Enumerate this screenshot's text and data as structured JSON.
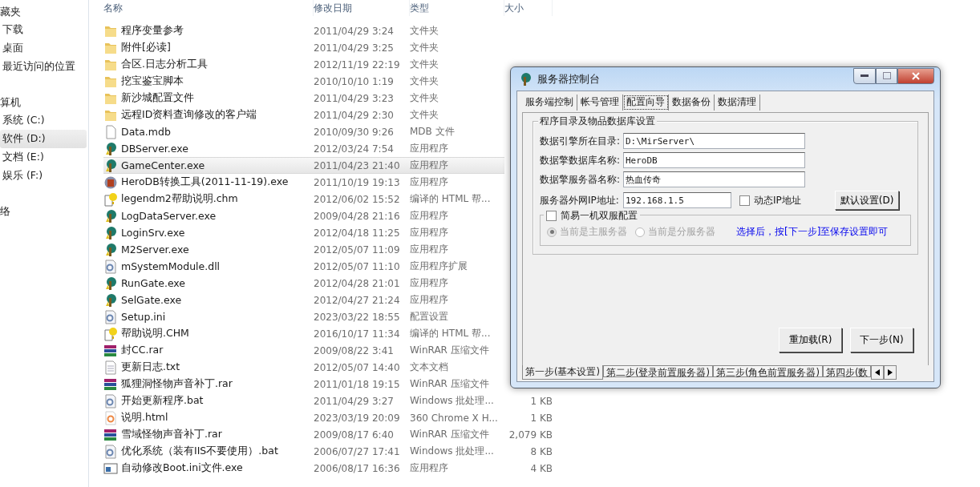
{
  "sidebar": {
    "items": [
      {
        "label": "藏夹",
        "kind": "header",
        "selected": false
      },
      {
        "label": "下载",
        "kind": "item",
        "selected": false
      },
      {
        "label": "桌面",
        "kind": "item",
        "selected": false
      },
      {
        "label": "最近访问的位置",
        "kind": "item",
        "selected": false
      },
      {
        "label": "算机",
        "kind": "header",
        "selected": false
      },
      {
        "label": "系统 (C:)",
        "kind": "item",
        "selected": false
      },
      {
        "label": "软件 (D:)",
        "kind": "item",
        "selected": true
      },
      {
        "label": "文档 (E:)",
        "kind": "item",
        "selected": false
      },
      {
        "label": "娱乐 (F:)",
        "kind": "item",
        "selected": false
      },
      {
        "label": "络",
        "kind": "header",
        "selected": false
      }
    ]
  },
  "file_list": {
    "columns": [
      "名称",
      "修改日期",
      "类型",
      "大小"
    ],
    "rows": [
      {
        "name": "程序变量参考",
        "date": "2011/04/29 3:24",
        "type": "文件夹",
        "kind": "folder",
        "selected": false
      },
      {
        "name": "附件[必读]",
        "date": "2011/04/29 3:25",
        "type": "文件夹",
        "kind": "folder",
        "selected": false
      },
      {
        "name": "合区.日志分析工具",
        "date": "2012/11/19 22:19",
        "type": "文件夹",
        "kind": "folder",
        "selected": false
      },
      {
        "name": "挖宝鉴宝脚本",
        "date": "2010/10/10 1:19",
        "type": "文件夹",
        "kind": "folder",
        "selected": false
      },
      {
        "name": "新沙城配置文件",
        "date": "2011/04/29 3:23",
        "type": "文件夹",
        "kind": "folder",
        "selected": false
      },
      {
        "name": "远程ID资料查询修改的客户端",
        "date": "2011/04/29 2:30",
        "type": "文件夹",
        "kind": "folder",
        "selected": false
      },
      {
        "name": "Data.mdb",
        "date": "2010/09/30 9:26",
        "type": "MDB 文件",
        "kind": "file",
        "selected": false
      },
      {
        "name": "DBServer.exe",
        "date": "2012/03/24 7:54",
        "type": "应用程序",
        "kind": "game",
        "selected": false
      },
      {
        "name": "GameCenter.exe",
        "date": "2011/04/23 21:40",
        "type": "应用程序",
        "kind": "game",
        "selected": true
      },
      {
        "name": "HeroDB转换工具(2011-11-19).exe",
        "date": "2011/10/19 19:13",
        "type": "应用程序",
        "kind": "tool",
        "selected": false
      },
      {
        "name": "legendm2帮助说明.chm",
        "date": "2012/06/02 15:52",
        "type": "编译的 HTML 帮...",
        "kind": "help",
        "selected": false
      },
      {
        "name": "LogDataServer.exe",
        "date": "2009/04/28 21:16",
        "type": "应用程序",
        "kind": "game",
        "selected": false
      },
      {
        "name": "LoginSrv.exe",
        "date": "2012/04/18 11:25",
        "type": "应用程序",
        "kind": "game",
        "selected": false
      },
      {
        "name": "M2Server.exe",
        "date": "2012/05/07 11:09",
        "type": "应用程序",
        "kind": "game",
        "selected": false
      },
      {
        "name": "mSystemModule.dll",
        "date": "2012/05/07 11:10",
        "type": "应用程序扩展",
        "kind": "gearfile",
        "selected": false
      },
      {
        "name": "RunGate.exe",
        "date": "2012/04/28 21:01",
        "type": "应用程序",
        "kind": "game",
        "selected": false
      },
      {
        "name": "SelGate.exe",
        "date": "2012/04/27 21:24",
        "type": "应用程序",
        "kind": "game",
        "selected": false
      },
      {
        "name": "Setup.ini",
        "date": "2023/03/22 18:55",
        "type": "配置设置",
        "kind": "gearfile",
        "selected": false
      },
      {
        "name": "帮助说明.CHM",
        "date": "2016/10/17 11:34",
        "type": "编译的 HTML 帮...",
        "kind": "help",
        "selected": false
      },
      {
        "name": "封CC.rar",
        "date": "2009/08/22 3:41",
        "type": "WinRAR 压缩文件",
        "kind": "archive",
        "selected": false
      },
      {
        "name": "更新日志.txt",
        "date": "2012/05/07 14:40",
        "type": "文本文档",
        "kind": "text",
        "selected": false
      },
      {
        "name": "狐狸洞怪物声音补丁.rar",
        "date": "2011/01/18 19:15",
        "type": "WinRAR 压缩文件",
        "kind": "archive",
        "selected": false
      },
      {
        "name": "开始更新程序.bat",
        "date": "2011/04/29 3:27",
        "type": "Windows 批处理...",
        "size": "1 KB",
        "kind": "gearfile",
        "selected": false
      },
      {
        "name": "说明.html",
        "date": "2023/03/19 20:09",
        "type": "360 Chrome X H...",
        "size": "1 KB",
        "kind": "web",
        "selected": false
      },
      {
        "name": "雪域怪物声音补丁.rar",
        "date": "2009/08/17 6:40",
        "type": "WinRAR 压缩文件",
        "size": "2,079 KB",
        "kind": "archive",
        "selected": false
      },
      {
        "name": "优化系统（装有IIS不要使用）.bat",
        "date": "2006/07/27 17:41",
        "type": "Windows 批处理...",
        "size": "8 KB",
        "kind": "gearfile",
        "selected": false
      },
      {
        "name": "自动修改Boot.ini文件.exe",
        "date": "2006/08/17 16:36",
        "type": "应用程序",
        "size": "4 KB",
        "kind": "window",
        "selected": false
      }
    ]
  },
  "dialog": {
    "title": "服务器控制台",
    "tabs": [
      {
        "label": "服务端控制",
        "selected": false
      },
      {
        "label": "帐号管理",
        "selected": false
      },
      {
        "label": "配置向导",
        "selected": true
      },
      {
        "label": "数据备份",
        "selected": false
      },
      {
        "label": "数据清理",
        "selected": false
      }
    ],
    "group_title": "程序目录及物品数据库设置",
    "fields": [
      {
        "label": "数据引擎所在目录:",
        "value": "D:\\MirServer\\"
      },
      {
        "label": "数据擎数据库名称:",
        "value": "HeroDB"
      },
      {
        "label": "数据擎服务器名称:",
        "value": "热血传奇"
      },
      {
        "label": "服务器外网IP地址:",
        "value": "192.168.1.5"
      }
    ],
    "dynamic_ip": {
      "label": "动态IP地址",
      "checked": false
    },
    "default_button": "默认设置(D)",
    "dual_server": {
      "label": "简易一机双服配置",
      "checked": false,
      "options": [
        {
          "label": "当前是主服务器",
          "selected": true,
          "disabled": true
        },
        {
          "label": "当前是分服务器",
          "selected": false,
          "disabled": true
        }
      ],
      "note": "选择后，按[下一步]至保存设置即可"
    },
    "buttons": [
      "重加载(R)",
      "下一步(N)"
    ],
    "step_tabs": [
      {
        "label": "第一步(基本设置)",
        "selected": true
      },
      {
        "label": "第二步(登录前置服务器)",
        "selected": false
      },
      {
        "label": "第三步(角色前置服务器)",
        "selected": false
      },
      {
        "label": "第四步(数",
        "selected": false
      }
    ]
  }
}
